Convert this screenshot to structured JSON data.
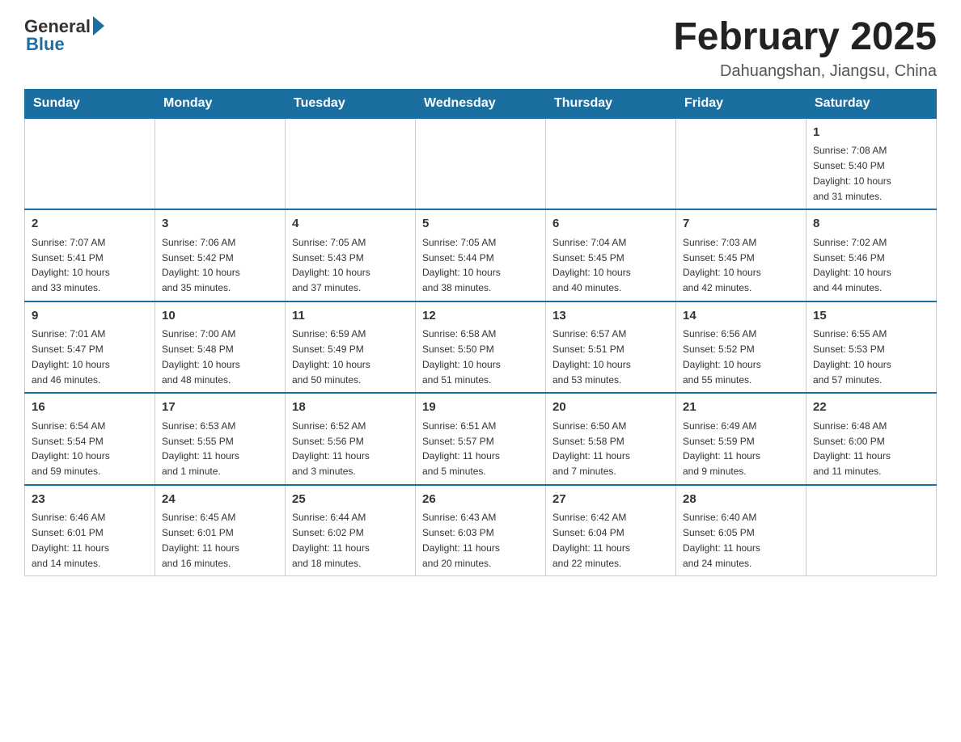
{
  "header": {
    "logo_general": "General",
    "logo_blue": "Blue",
    "month_title": "February 2025",
    "location": "Dahuangshan, Jiangsu, China"
  },
  "weekdays": [
    "Sunday",
    "Monday",
    "Tuesday",
    "Wednesday",
    "Thursday",
    "Friday",
    "Saturday"
  ],
  "weeks": [
    [
      {
        "day": "",
        "info": ""
      },
      {
        "day": "",
        "info": ""
      },
      {
        "day": "",
        "info": ""
      },
      {
        "day": "",
        "info": ""
      },
      {
        "day": "",
        "info": ""
      },
      {
        "day": "",
        "info": ""
      },
      {
        "day": "1",
        "info": "Sunrise: 7:08 AM\nSunset: 5:40 PM\nDaylight: 10 hours\nand 31 minutes."
      }
    ],
    [
      {
        "day": "2",
        "info": "Sunrise: 7:07 AM\nSunset: 5:41 PM\nDaylight: 10 hours\nand 33 minutes."
      },
      {
        "day": "3",
        "info": "Sunrise: 7:06 AM\nSunset: 5:42 PM\nDaylight: 10 hours\nand 35 minutes."
      },
      {
        "day": "4",
        "info": "Sunrise: 7:05 AM\nSunset: 5:43 PM\nDaylight: 10 hours\nand 37 minutes."
      },
      {
        "day": "5",
        "info": "Sunrise: 7:05 AM\nSunset: 5:44 PM\nDaylight: 10 hours\nand 38 minutes."
      },
      {
        "day": "6",
        "info": "Sunrise: 7:04 AM\nSunset: 5:45 PM\nDaylight: 10 hours\nand 40 minutes."
      },
      {
        "day": "7",
        "info": "Sunrise: 7:03 AM\nSunset: 5:45 PM\nDaylight: 10 hours\nand 42 minutes."
      },
      {
        "day": "8",
        "info": "Sunrise: 7:02 AM\nSunset: 5:46 PM\nDaylight: 10 hours\nand 44 minutes."
      }
    ],
    [
      {
        "day": "9",
        "info": "Sunrise: 7:01 AM\nSunset: 5:47 PM\nDaylight: 10 hours\nand 46 minutes."
      },
      {
        "day": "10",
        "info": "Sunrise: 7:00 AM\nSunset: 5:48 PM\nDaylight: 10 hours\nand 48 minutes."
      },
      {
        "day": "11",
        "info": "Sunrise: 6:59 AM\nSunset: 5:49 PM\nDaylight: 10 hours\nand 50 minutes."
      },
      {
        "day": "12",
        "info": "Sunrise: 6:58 AM\nSunset: 5:50 PM\nDaylight: 10 hours\nand 51 minutes."
      },
      {
        "day": "13",
        "info": "Sunrise: 6:57 AM\nSunset: 5:51 PM\nDaylight: 10 hours\nand 53 minutes."
      },
      {
        "day": "14",
        "info": "Sunrise: 6:56 AM\nSunset: 5:52 PM\nDaylight: 10 hours\nand 55 minutes."
      },
      {
        "day": "15",
        "info": "Sunrise: 6:55 AM\nSunset: 5:53 PM\nDaylight: 10 hours\nand 57 minutes."
      }
    ],
    [
      {
        "day": "16",
        "info": "Sunrise: 6:54 AM\nSunset: 5:54 PM\nDaylight: 10 hours\nand 59 minutes."
      },
      {
        "day": "17",
        "info": "Sunrise: 6:53 AM\nSunset: 5:55 PM\nDaylight: 11 hours\nand 1 minute."
      },
      {
        "day": "18",
        "info": "Sunrise: 6:52 AM\nSunset: 5:56 PM\nDaylight: 11 hours\nand 3 minutes."
      },
      {
        "day": "19",
        "info": "Sunrise: 6:51 AM\nSunset: 5:57 PM\nDaylight: 11 hours\nand 5 minutes."
      },
      {
        "day": "20",
        "info": "Sunrise: 6:50 AM\nSunset: 5:58 PM\nDaylight: 11 hours\nand 7 minutes."
      },
      {
        "day": "21",
        "info": "Sunrise: 6:49 AM\nSunset: 5:59 PM\nDaylight: 11 hours\nand 9 minutes."
      },
      {
        "day": "22",
        "info": "Sunrise: 6:48 AM\nSunset: 6:00 PM\nDaylight: 11 hours\nand 11 minutes."
      }
    ],
    [
      {
        "day": "23",
        "info": "Sunrise: 6:46 AM\nSunset: 6:01 PM\nDaylight: 11 hours\nand 14 minutes."
      },
      {
        "day": "24",
        "info": "Sunrise: 6:45 AM\nSunset: 6:01 PM\nDaylight: 11 hours\nand 16 minutes."
      },
      {
        "day": "25",
        "info": "Sunrise: 6:44 AM\nSunset: 6:02 PM\nDaylight: 11 hours\nand 18 minutes."
      },
      {
        "day": "26",
        "info": "Sunrise: 6:43 AM\nSunset: 6:03 PM\nDaylight: 11 hours\nand 20 minutes."
      },
      {
        "day": "27",
        "info": "Sunrise: 6:42 AM\nSunset: 6:04 PM\nDaylight: 11 hours\nand 22 minutes."
      },
      {
        "day": "28",
        "info": "Sunrise: 6:40 AM\nSunset: 6:05 PM\nDaylight: 11 hours\nand 24 minutes."
      },
      {
        "day": "",
        "info": ""
      }
    ]
  ]
}
